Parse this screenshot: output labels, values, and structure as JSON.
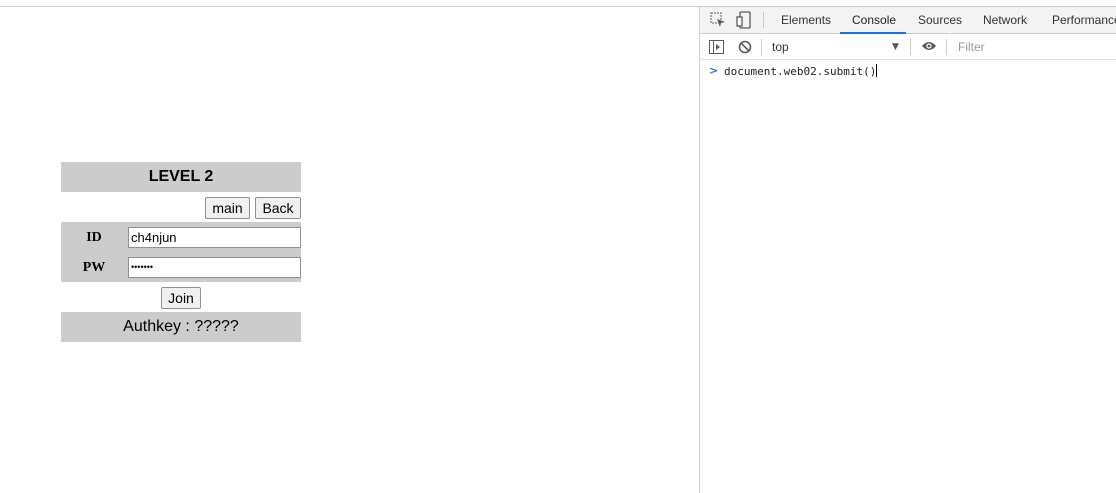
{
  "page": {
    "title": "LEVEL 2",
    "buttons": {
      "main": "main",
      "back": "Back",
      "join": "Join"
    },
    "form": {
      "id_label": "ID",
      "pw_label": "PW",
      "id_value": "ch4njun",
      "pw_value": "•••••••"
    },
    "authkey": "Authkey : ?????"
  },
  "devtools": {
    "tabs": [
      "Elements",
      "Console",
      "Sources",
      "Network",
      "Performance"
    ],
    "active_tab": "Console",
    "context": "top",
    "filter_placeholder": "Filter",
    "console_input": "document.web02.submit()",
    "accent_color": "#1a73e8",
    "icons": [
      "inspect-icon",
      "device-icon",
      "sidebar-icon",
      "clear-icon",
      "eye-icon",
      "prompt-icon"
    ]
  }
}
